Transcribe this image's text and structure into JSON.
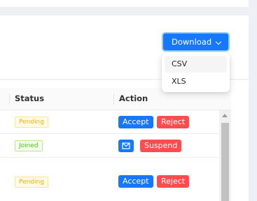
{
  "table": {
    "columns": {
      "status": "Status",
      "action": "Action"
    },
    "rows": [
      {
        "status": "Pending",
        "status_kind": "pending",
        "actions": [
          "Accept",
          "Reject"
        ]
      },
      {
        "status": "Joined",
        "status_kind": "joined",
        "actions": [
          "mail-icon",
          "Suspend"
        ]
      },
      {
        "status": "Pending",
        "status_kind": "pending",
        "actions": [
          "Accept",
          "Reject"
        ]
      }
    ]
  },
  "download": {
    "label": "Download",
    "options": [
      "CSV",
      "XLS"
    ]
  },
  "colors": {
    "primary": "#1677ff",
    "danger": "#ff4d4f",
    "pending": "#faad14",
    "joined": "#52c41a"
  }
}
